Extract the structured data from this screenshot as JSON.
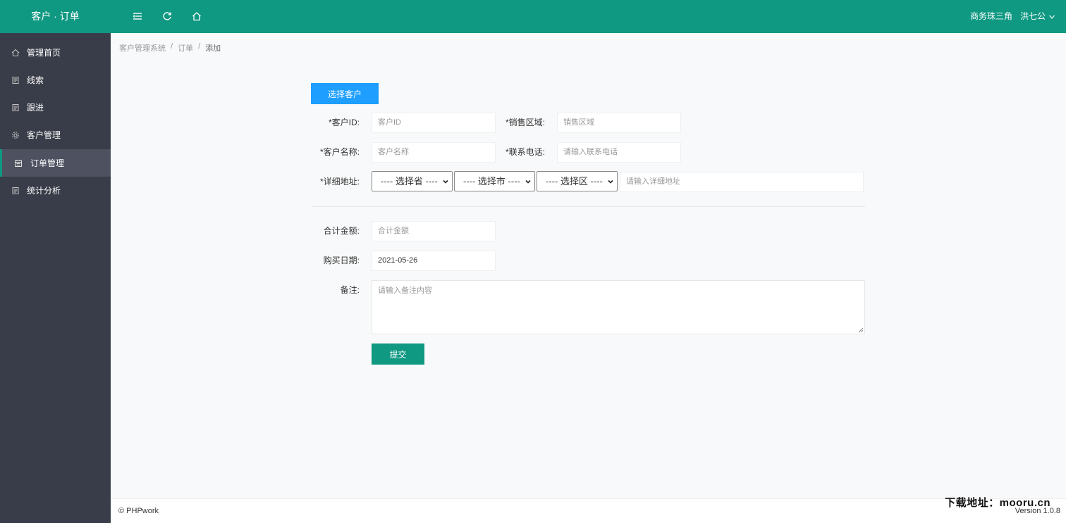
{
  "header": {
    "brand": "客户 · 订单",
    "region": "商务珠三角",
    "user": "洪七公"
  },
  "sidebar": {
    "items": [
      {
        "label": "管理首页",
        "icon": "home-icon"
      },
      {
        "label": "线索",
        "icon": "doc-icon"
      },
      {
        "label": "跟进",
        "icon": "doc-icon"
      },
      {
        "label": "客户管理",
        "icon": "gear-icon"
      },
      {
        "label": "订单管理",
        "icon": "calendar-icon",
        "active": true
      },
      {
        "label": "统计分析",
        "icon": "doc-icon"
      }
    ]
  },
  "breadcrumb": {
    "items": [
      "客户管理系统",
      "订单",
      "添加"
    ],
    "sep": "/"
  },
  "form": {
    "select_customer_button": "选择客户",
    "customer_id": {
      "label": "*客户ID:",
      "placeholder": "客户ID"
    },
    "sales_region": {
      "label": "*销售区域:",
      "placeholder": "销售区域"
    },
    "customer_name": {
      "label": "*客户名称:",
      "placeholder": "客户名称"
    },
    "phone": {
      "label": "*联系电话:",
      "placeholder": "请输入联系电话"
    },
    "address": {
      "label": "*详细地址:",
      "province": "---- 选择省 ----",
      "city": "---- 选择市 ----",
      "district": "---- 选择区 ----",
      "detail_placeholder": "请输入详细地址"
    },
    "total_amount": {
      "label": "合计金额:",
      "placeholder": "合计金额"
    },
    "purchase_date": {
      "label": "购买日期:",
      "value": "2021-05-26"
    },
    "remark": {
      "label": "备注:",
      "placeholder": "请输入备注内容"
    },
    "submit_button": "提交"
  },
  "footer": {
    "copyright": "© PHPwork",
    "version": "Version 1.0.8",
    "watermark": "下载地址：mooru.cn"
  },
  "colors": {
    "header_bg": "#0f9882",
    "sidebar_bg": "#393d49",
    "primary_blue": "#1e9fff",
    "primary_green": "#0f9882"
  }
}
